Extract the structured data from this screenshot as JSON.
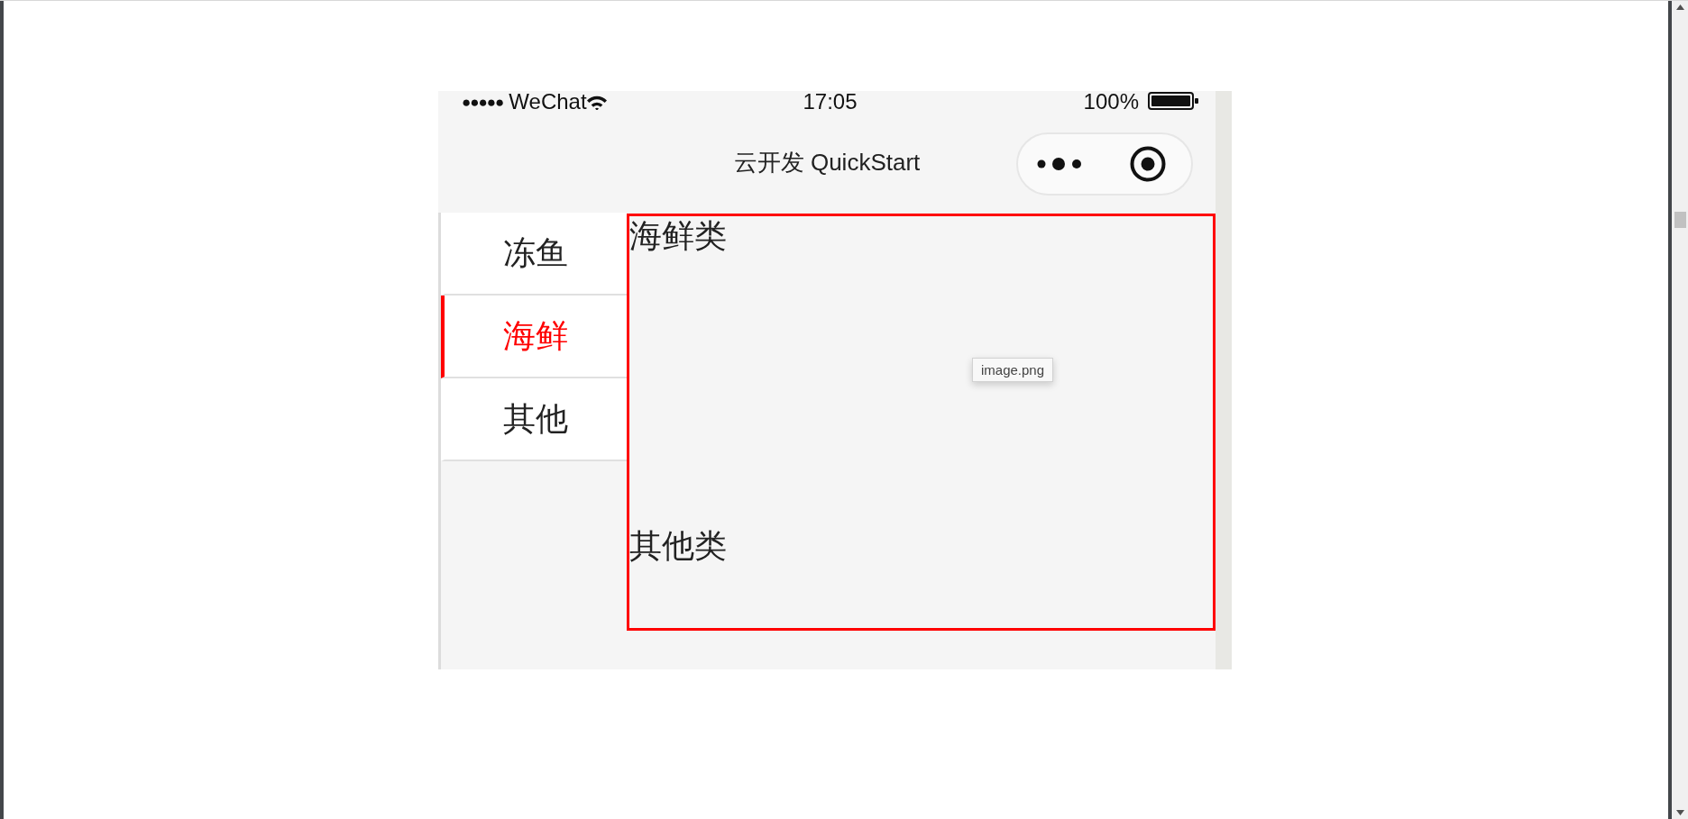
{
  "status_bar": {
    "signal": "●●●●●",
    "carrier": "WeChat",
    "time": "17:05",
    "battery": "100%"
  },
  "nav_bar": {
    "title": "云开发 QuickStart"
  },
  "sidebar": {
    "items": [
      {
        "label": "冻鱼",
        "selected": false
      },
      {
        "label": "海鲜",
        "selected": true
      },
      {
        "label": "其他",
        "selected": false
      }
    ]
  },
  "content": {
    "sections": [
      {
        "title": "海鲜类"
      },
      {
        "title": "其他类"
      }
    ],
    "tooltip": "image.png"
  }
}
